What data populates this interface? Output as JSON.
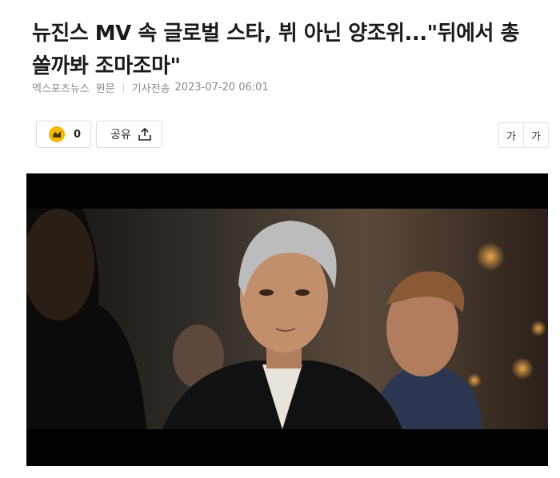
{
  "article": {
    "title": "뉴진스 MV 속 글로벌 스타, 뷔 아닌 양조위...\"뒤에서 총 쏠까봐 조마조마\"",
    "source": "엑스포츠뉴스",
    "origin_label": "원문",
    "sent_label": "기사전송",
    "datetime": "2023-07-20 06:01"
  },
  "actions": {
    "like_count": "0",
    "share_label": "공유"
  },
  "font_controls": {
    "decrease": "가",
    "increase": "가"
  },
  "colors": {
    "like_icon_bg": "#f5b800",
    "video_bg": "#000000"
  }
}
